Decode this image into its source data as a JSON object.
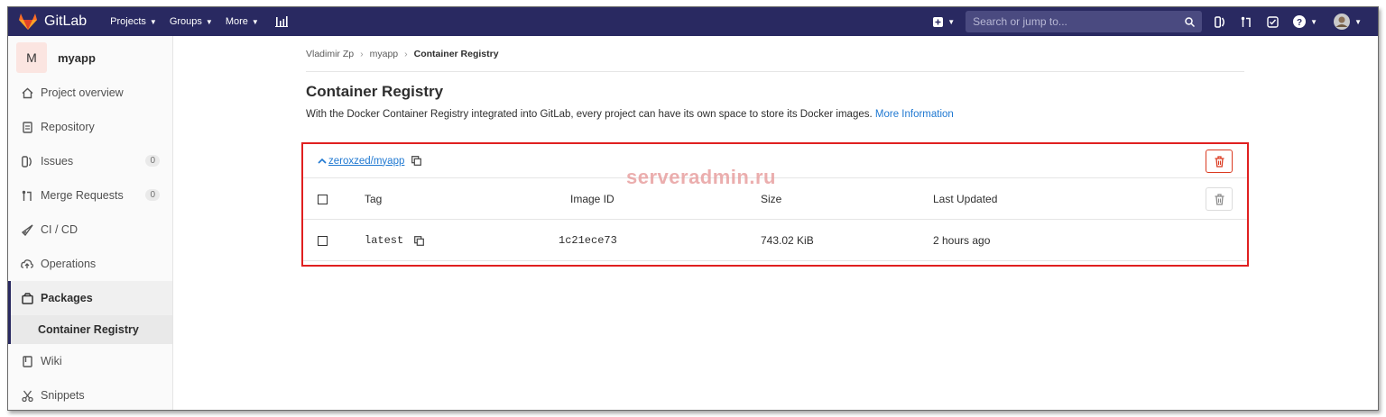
{
  "nav": {
    "brand": "GitLab",
    "projects": "Projects",
    "groups": "Groups",
    "more": "More",
    "search_placeholder": "Search or jump to..."
  },
  "sidebar": {
    "avatar_letter": "M",
    "project_name": "myapp",
    "items": [
      {
        "label": "Project overview"
      },
      {
        "label": "Repository"
      },
      {
        "label": "Issues",
        "badge": "0"
      },
      {
        "label": "Merge Requests",
        "badge": "0"
      },
      {
        "label": "CI / CD"
      },
      {
        "label": "Operations"
      },
      {
        "label": "Packages"
      },
      {
        "label": "Wiki"
      },
      {
        "label": "Snippets"
      }
    ],
    "sub_item": "Container Registry"
  },
  "breadcrumb": {
    "user": "Vladimir Zp",
    "project": "myapp",
    "current": "Container Registry"
  },
  "page": {
    "title": "Container Registry",
    "description": "With the Docker Container Registry integrated into GitLab, every project can have its own space to store its Docker images.",
    "more_info": "More Information"
  },
  "registry": {
    "name": "zeroxzed/myapp",
    "columns": {
      "tag": "Tag",
      "image_id": "Image ID",
      "size": "Size",
      "updated": "Last Updated"
    },
    "rows": [
      {
        "tag": "latest",
        "image_id": "1c21ece73",
        "size": "743.02 KiB",
        "updated": "2 hours ago"
      }
    ]
  },
  "watermark": "serveradmin.ru",
  "colors": {
    "nav_bg": "#292961",
    "danger": "#db3b21",
    "link": "#1f78d1",
    "highlight_border": "#e02020"
  }
}
